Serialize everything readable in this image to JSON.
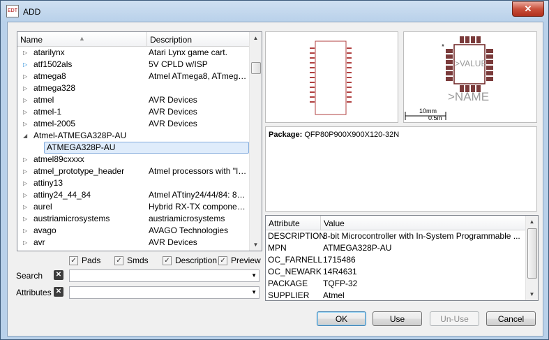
{
  "window": {
    "title": "ADD",
    "close": "✕",
    "app_icon": "EDT"
  },
  "tree": {
    "columns": [
      "Name",
      "Description"
    ],
    "rows": [
      {
        "name": "atarilynx",
        "desc": "Atari Lynx game cart.",
        "expander": "▷"
      },
      {
        "name": "atf1502als",
        "desc": "5V CPLD w/ISP",
        "expander": "▷"
      },
      {
        "name": "atmega8",
        "desc": "Atmel ATmega8, ATmeg…",
        "expander": "▷"
      },
      {
        "name": "atmega328",
        "desc": "",
        "expander": "▷"
      },
      {
        "name": "atmel",
        "desc": "AVR Devices",
        "expander": "▷"
      },
      {
        "name": "atmel-1",
        "desc": "AVR Devices",
        "expander": "▷"
      },
      {
        "name": "atmel-2005",
        "desc": "AVR Devices",
        "expander": "▷"
      },
      {
        "name": "Atmel-ATMEGA328P-AU",
        "desc": "",
        "expander": "◢"
      },
      {
        "name": "ATMEGA328P-AU",
        "desc": "",
        "expander": ""
      },
      {
        "name": "atmel89cxxxx",
        "desc": "",
        "expander": "▷"
      },
      {
        "name": "atmel_prototype_header",
        "desc": "Atmel processors with \"I…",
        "expander": "▷"
      },
      {
        "name": "attiny13",
        "desc": "",
        "expander": "▷"
      },
      {
        "name": "attiny24_44_84",
        "desc": "Atmel ATtiny24/44/84: 8…",
        "expander": "▷"
      },
      {
        "name": "aurel",
        "desc": "Hybrid RX-TX compone…",
        "expander": "▷"
      },
      {
        "name": "austriamicrosystems",
        "desc": "austriamicrosystems",
        "expander": "▷"
      },
      {
        "name": "avago",
        "desc": "AVAGO Technologies",
        "expander": "▷"
      },
      {
        "name": "avr",
        "desc": "AVR Devices",
        "expander": "▷"
      }
    ]
  },
  "options": {
    "pads": "Pads",
    "smds": "Smds",
    "description": "Description",
    "preview": "Preview"
  },
  "search": {
    "label": "Search",
    "value": ""
  },
  "attributes_filter": {
    "label": "Attributes",
    "value": ""
  },
  "preview": {
    "package_label": "Package:",
    "package_name": "QFP80P900X900X120-32N",
    "symbol_value": ">VALUE",
    "symbol_name": ">NAME",
    "scale_mm": "10mm",
    "scale_in": "0.5in"
  },
  "attributes": {
    "columns": [
      "Attribute",
      "Value"
    ],
    "rows": [
      {
        "key": "DESCRIPTION",
        "value": "8-bit Microcontroller with In-System Programmable ..."
      },
      {
        "key": "MPN",
        "value": "ATMEGA328P-AU"
      },
      {
        "key": "OC_FARNELL",
        "value": "1715486"
      },
      {
        "key": "OC_NEWARK",
        "value": "14R4631"
      },
      {
        "key": "PACKAGE",
        "value": "TQFP-32"
      },
      {
        "key": "SUPPLIER",
        "value": "Atmel"
      }
    ]
  },
  "buttons": {
    "ok": "OK",
    "use": "Use",
    "unuse": "Un-Use",
    "cancel": "Cancel"
  }
}
